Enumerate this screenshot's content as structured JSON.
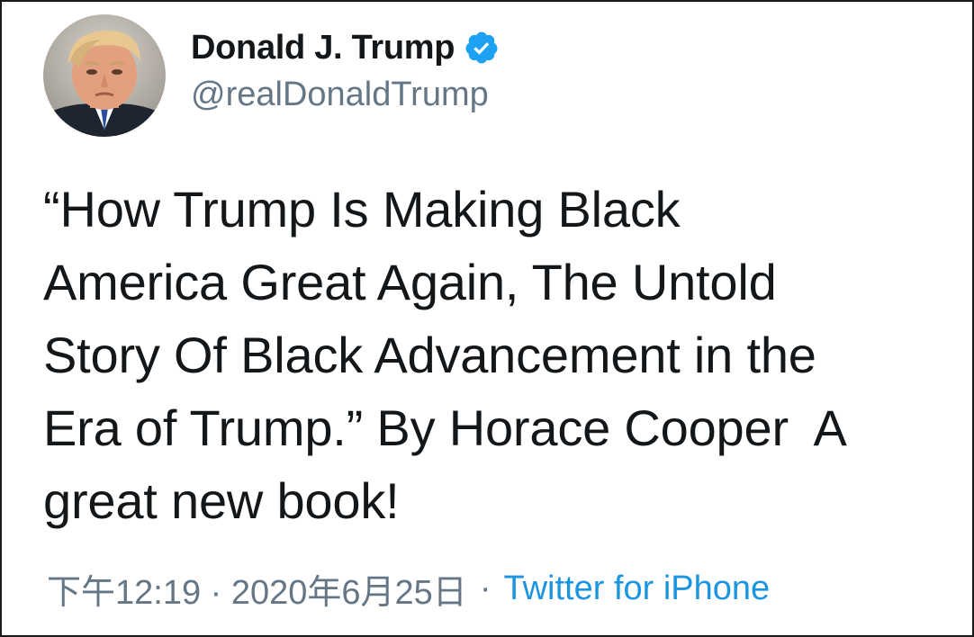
{
  "tweet": {
    "author": {
      "display_name": "Donald J. Trump",
      "handle": "@realDonaldTrump",
      "verified": true,
      "avatar_icon": "profile-photo"
    },
    "text": "“How Trump Is Making Black\nAmerica Great Again, The Untold\nStory Of Black Advancement in the\nEra of Trump.” By Horace Cooper  A\ngreat new book!",
    "timestamp": "下午12:19 · 2020年6月25日",
    "separator": "·",
    "source": "Twitter for iPhone"
  },
  "colors": {
    "text_primary": "#14171a",
    "text_secondary": "#657786",
    "link": "#1b95e0",
    "verified_badge": "#1da1f2",
    "border": "#1a1a1a",
    "background": "#ffffff"
  }
}
